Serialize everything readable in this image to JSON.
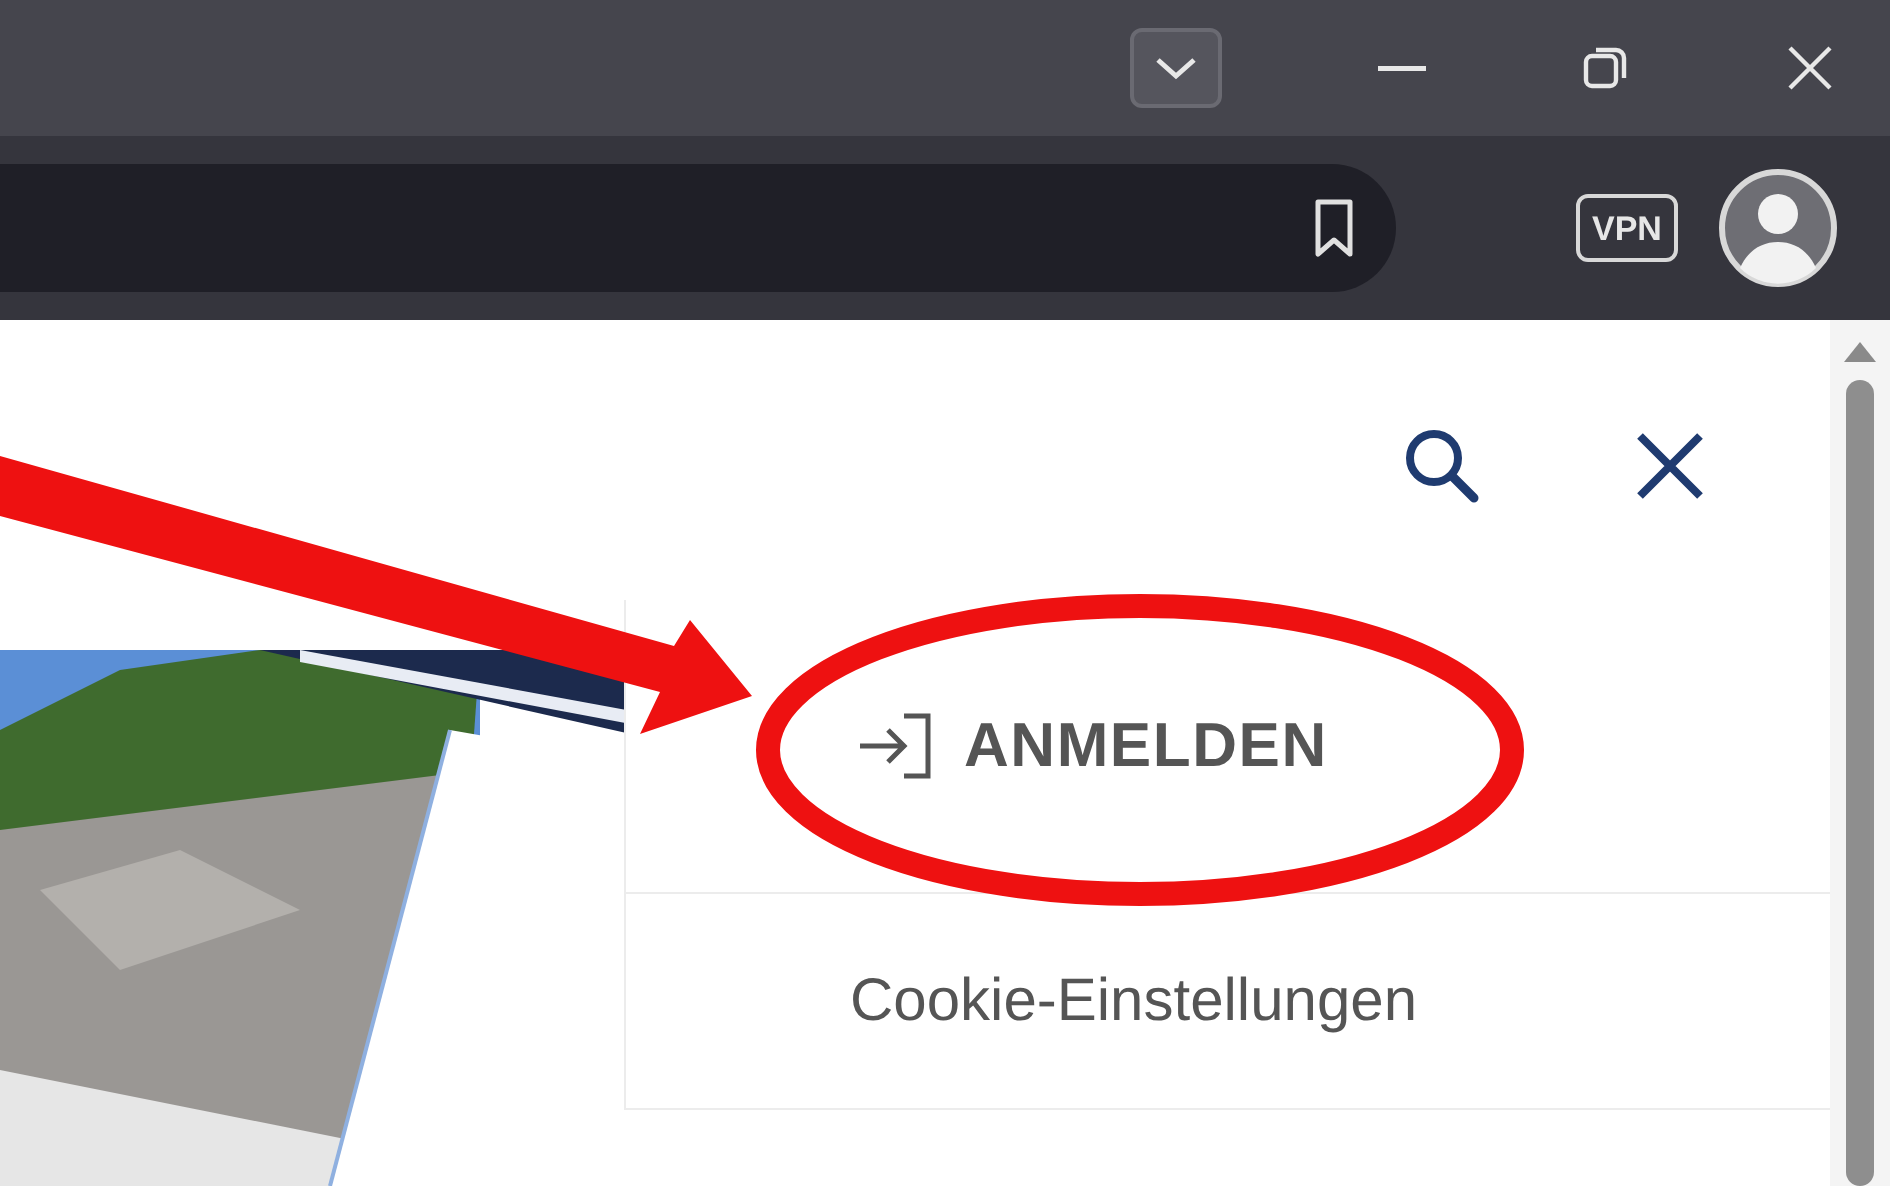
{
  "browser": {
    "vpn_label": "VPN"
  },
  "menu": {
    "items": [
      {
        "kind": "login",
        "label": "ANMELDEN"
      },
      {
        "kind": "link",
        "label": "Cookie-Einstellungen"
      }
    ]
  }
}
